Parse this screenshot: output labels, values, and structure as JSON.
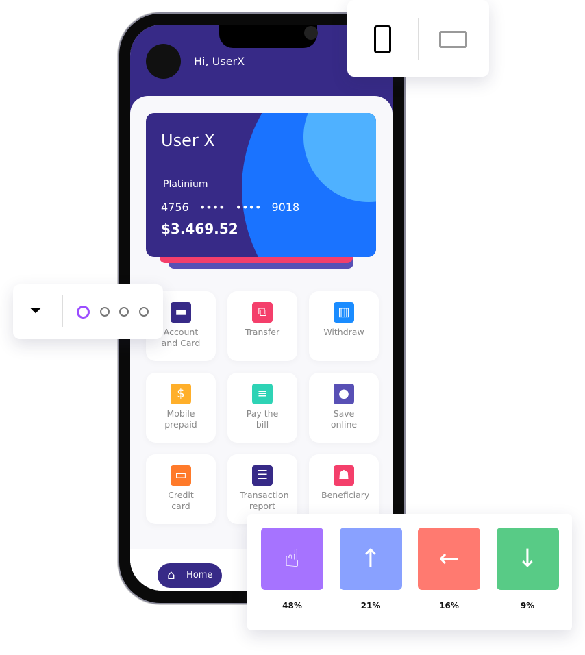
{
  "header": {
    "greeting": "Hi, UserX"
  },
  "card": {
    "holder": "User X",
    "tier": "Platinium",
    "number_first": "4756",
    "number_masked": "•••• ••••",
    "number_last": "9018",
    "balance": "$3.469.52",
    "colors": {
      "base": "#372a87",
      "blue": "#1a73ff",
      "light": "#4fb1ff"
    }
  },
  "services": [
    {
      "label": "Account and Card",
      "icon": "wallet-icon",
      "color": "#372a87"
    },
    {
      "label": "Transfer",
      "icon": "transfer-icon",
      "color": "#f43f6b"
    },
    {
      "label": "Withdraw",
      "icon": "atm-icon",
      "color": "#1a8cff"
    },
    {
      "label": "Mobile prepaid",
      "icon": "dollar-icon",
      "color": "#ffaf2a"
    },
    {
      "label": "Pay the bill",
      "icon": "receipt-icon",
      "color": "#2ed3b5"
    },
    {
      "label": "Save online",
      "icon": "piggy-bank-icon",
      "color": "#5850b5"
    },
    {
      "label": "Credit card",
      "icon": "credit-card-icon",
      "color": "#ff7a2a"
    },
    {
      "label": "Transaction report",
      "icon": "report-icon",
      "color": "#372a87"
    },
    {
      "label": "Beneficiary",
      "icon": "contact-book-icon",
      "color": "#f43f6b"
    }
  ],
  "nav": {
    "home": "Home"
  },
  "stats": [
    {
      "icon": "tap-icon",
      "value": "48%",
      "color": "#a673ff"
    },
    {
      "icon": "arrow-up-icon",
      "value": "21%",
      "color": "#89a1ff"
    },
    {
      "icon": "arrow-left-icon",
      "value": "16%",
      "color": "#ff7a70"
    },
    {
      "icon": "arrow-down-icon",
      "value": "9%",
      "color": "#58cb86"
    }
  ]
}
